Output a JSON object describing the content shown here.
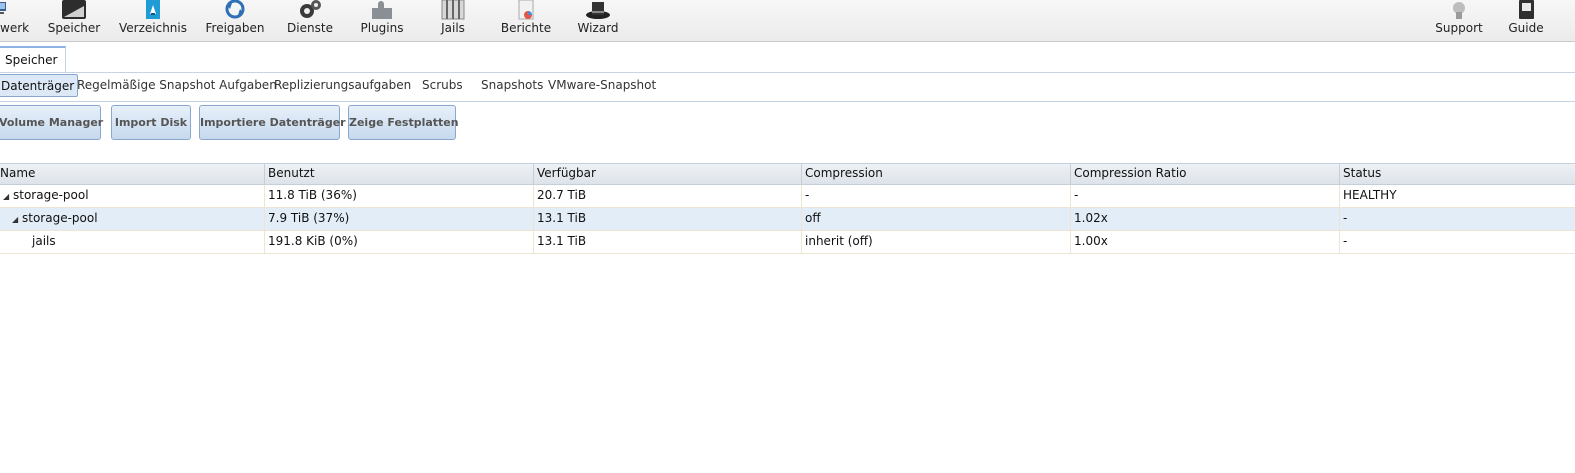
{
  "toolbar": {
    "items": [
      {
        "label": "werk",
        "icon": "network-icon"
      },
      {
        "label": "Speicher",
        "icon": "storage-icon"
      },
      {
        "label": "Verzeichnis",
        "icon": "directory-icon"
      },
      {
        "label": "Freigaben",
        "icon": "sharing-icon"
      },
      {
        "label": "Dienste",
        "icon": "services-icon"
      },
      {
        "label": "Plugins",
        "icon": "plugins-icon"
      },
      {
        "label": "Jails",
        "icon": "jails-icon"
      },
      {
        "label": "Berichte",
        "icon": "reports-icon"
      },
      {
        "label": "Wizard",
        "icon": "wizard-icon"
      },
      {
        "label": "Support",
        "icon": "support-icon"
      },
      {
        "label": "Guide",
        "icon": "guide-icon"
      }
    ]
  },
  "tab": {
    "label": "Speicher"
  },
  "subtabs": [
    "Datenträger",
    "Regelmäßige Snapshot Aufgaben",
    "Replizierungsaufgaben",
    "Scrubs",
    "Snapshots",
    "VMware-Snapshot"
  ],
  "buttons": [
    "Volume Manager",
    "Import Disk",
    "Importiere Datenträger",
    "Zeige Festplatten"
  ],
  "grid": {
    "columns": [
      "Name",
      "Benutzt",
      "Verfügbar",
      "Compression",
      "Compression Ratio",
      "Status"
    ],
    "rows": [
      {
        "name": "storage-pool",
        "used": "11.8 TiB (36%)",
        "avail": "20.7 TiB",
        "compression": "-",
        "ratio": "-",
        "status": "HEALTHY"
      },
      {
        "name": "storage-pool",
        "used": "7.9 TiB (37%)",
        "avail": "13.1 TiB",
        "compression": "off",
        "ratio": "1.02x",
        "status": "-"
      },
      {
        "name": "jails",
        "used": "191.8 KiB (0%)",
        "avail": "13.1 TiB",
        "compression": "inherit (off)",
        "ratio": "1.00x",
        "status": "-"
      }
    ]
  },
  "colors": {
    "accent": "#8db2e3",
    "selected_row": "#e3edf8",
    "button_border": "#8aa8cc"
  }
}
